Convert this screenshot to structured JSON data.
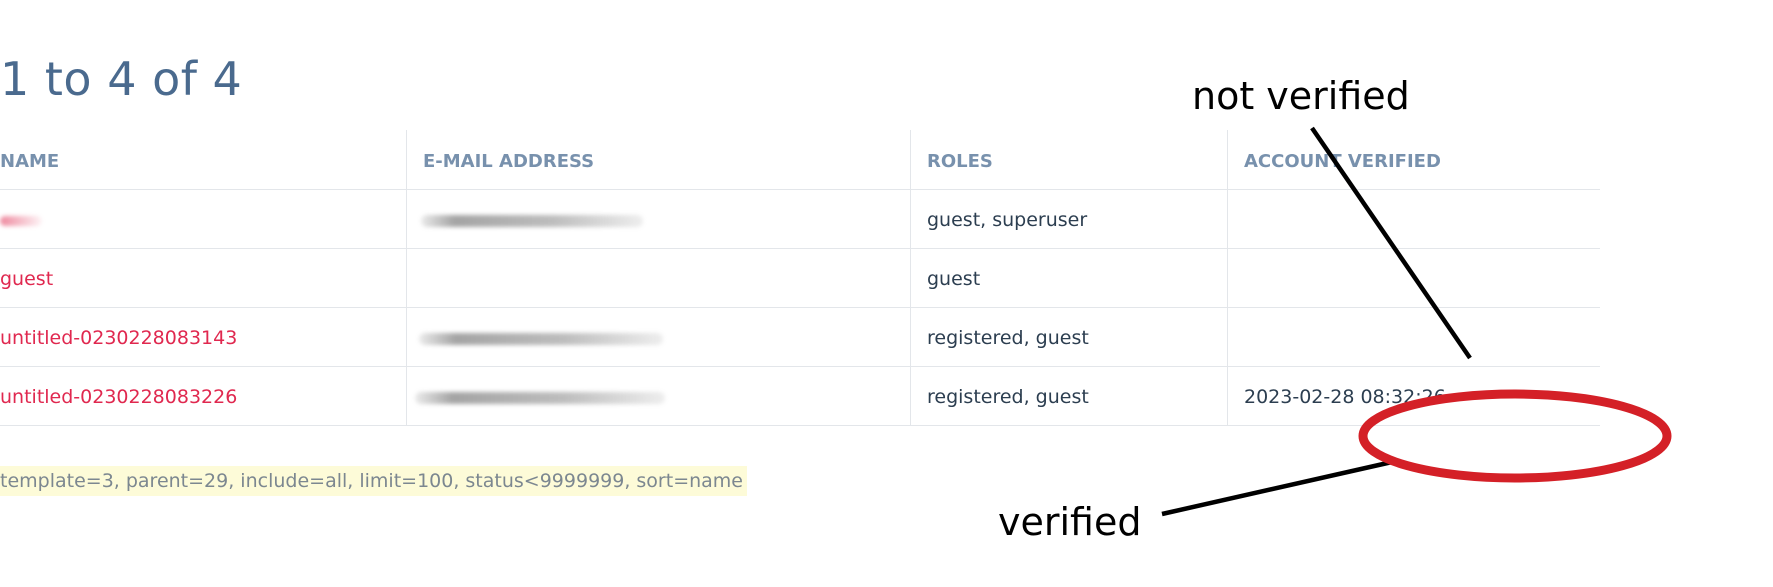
{
  "results_summary": "1 to 4 of 4",
  "table": {
    "headers": {
      "name": "NAME",
      "email": "E-MAIL ADDRESS",
      "roles": "ROLES",
      "verified": "ACCOUNT VERIFIED"
    },
    "rows": [
      {
        "name": "",
        "name_redacted": true,
        "email": "",
        "email_redacted": true,
        "roles": "guest, superuser",
        "verified": ""
      },
      {
        "name": "guest",
        "name_redacted": false,
        "email": "",
        "email_redacted": false,
        "roles": "guest",
        "verified": ""
      },
      {
        "name": "untitled-0230228083143",
        "name_redacted": false,
        "email": "",
        "email_redacted": true,
        "roles": "registered, guest",
        "verified": ""
      },
      {
        "name": "untitled-0230228083226",
        "name_redacted": false,
        "email": "",
        "email_redacted": true,
        "roles": "registered, guest",
        "verified": "2023-02-28 08:32:26"
      }
    ]
  },
  "selector_text": "template=3, parent=29, include=all, limit=100, status<9999999, sort=name",
  "annotations": {
    "not_verified": "not verified",
    "verified": "verified"
  },
  "colors": {
    "link": "#e0284f",
    "header": "#7891ad",
    "title": "#4a6a8e",
    "highlight_ellipse": "#d42027",
    "selector_bg": "#fdfbd8"
  }
}
